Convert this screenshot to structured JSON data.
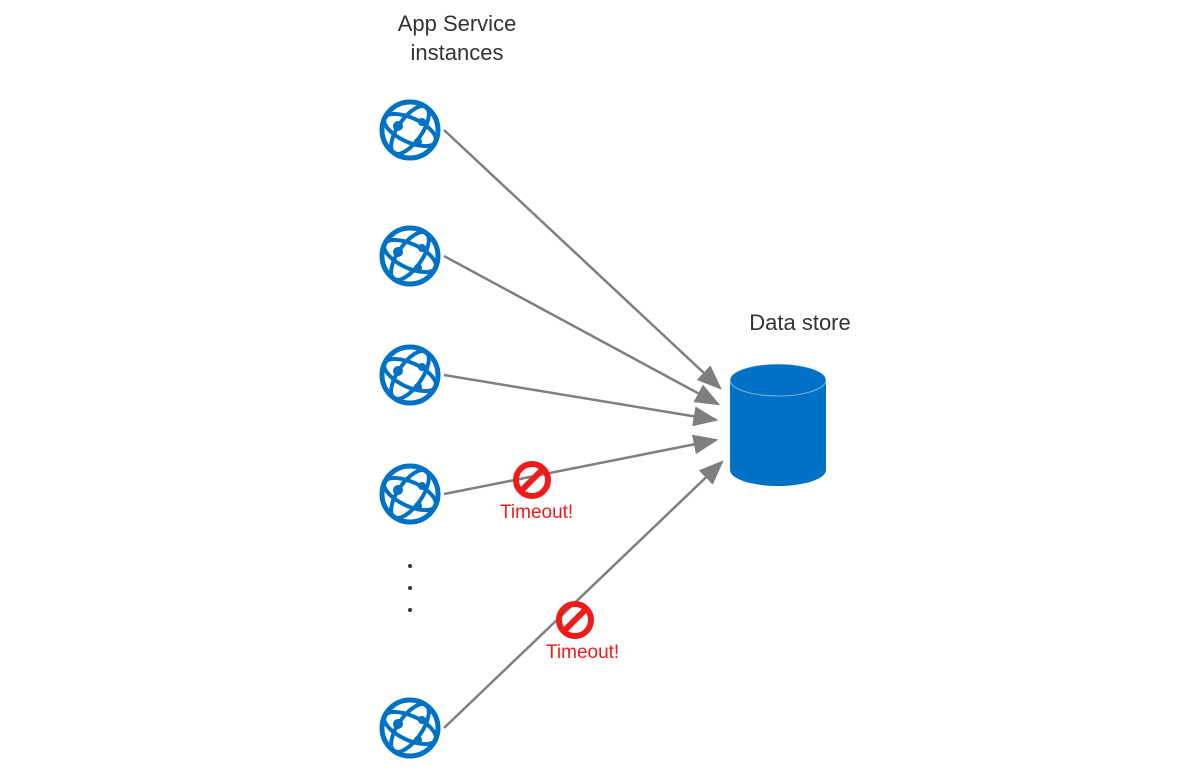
{
  "labels": {
    "app_service_line1": "App Service",
    "app_service_line2": "instances",
    "data_store": "Data store",
    "timeout1": "Timeout!",
    "timeout2": "Timeout!"
  },
  "colors": {
    "azure_blue": "#0072C6",
    "arrow_gray": "#7F7F7F",
    "prohibit_red": "#EF1A1A",
    "text_dark": "#333333"
  },
  "diagram": {
    "type": "architecture",
    "description": "Multiple App Service instances connecting to a single Data store; two later connections experience Timeout errors (marked with prohibition icons).",
    "app_instances": [
      {
        "id": 1,
        "timeout": false
      },
      {
        "id": 2,
        "timeout": false
      },
      {
        "id": 3,
        "timeout": false
      },
      {
        "id": 4,
        "timeout": true
      },
      {
        "id": "n",
        "timeout": true
      }
    ],
    "target": "data_store"
  }
}
